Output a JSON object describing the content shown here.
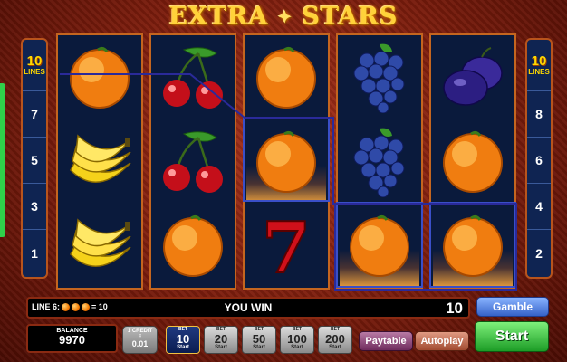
{
  "game": {
    "title_left": "EXTRA",
    "title_right": "STARS"
  },
  "lines_left": {
    "count": "10",
    "label": "LINES",
    "numbers": [
      "7",
      "5",
      "3",
      "1"
    ]
  },
  "lines_right": {
    "count": "10",
    "label": "LINES",
    "numbers": [
      "8",
      "6",
      "4",
      "2"
    ]
  },
  "reels": [
    [
      "orange",
      "banana",
      "banana"
    ],
    [
      "cherry",
      "cherry",
      "orange"
    ],
    [
      "orange",
      "orange",
      "seven"
    ],
    [
      "grapes",
      "grapes",
      "orange"
    ],
    [
      "plum",
      "orange",
      "orange"
    ]
  ],
  "win_info": {
    "line_text": "LINE 6:",
    "equals_text": "= 10",
    "you_win_label": "YOU WIN",
    "win_amount": "10"
  },
  "buttons": {
    "gamble": "Gamble",
    "start": "Start",
    "paytable": "Paytable",
    "autoplay": "Autoplay"
  },
  "balance": {
    "label": "BALANCE",
    "value": "9970"
  },
  "credit": {
    "line1": "1 CREDIT",
    "line2": "=",
    "value": "0.01"
  },
  "bets": [
    {
      "top": "BET",
      "value": "10",
      "sub": "Start",
      "active": true
    },
    {
      "top": "BET",
      "value": "20",
      "sub": "Start",
      "active": false
    },
    {
      "top": "BET",
      "value": "50",
      "sub": "Start",
      "active": false
    },
    {
      "top": "BET",
      "value": "100",
      "sub": "Start",
      "active": false
    },
    {
      "top": "BET",
      "value": "200",
      "sub": "Start",
      "active": false
    }
  ],
  "colors": {
    "accent_gold": "#ffd23a",
    "reel_bg": "#0a1a3c",
    "win_frame": "#3a4fc8"
  }
}
